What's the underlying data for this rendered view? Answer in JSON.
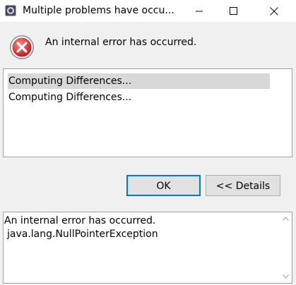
{
  "window": {
    "title": "Multiple problems have occu..."
  },
  "header": {
    "message": "An internal error has occurred."
  },
  "problems": [
    {
      "label": "Computing Differences...",
      "selected": true
    },
    {
      "label": "Computing Differences...",
      "selected": false
    }
  ],
  "buttons": {
    "ok_label": "OK",
    "details_label": "<< Details"
  },
  "details": {
    "lines": [
      "An internal error has occurred.",
      "java.lang.NullPointerException"
    ]
  },
  "colors": {
    "error_red": "#e04343",
    "focus_blue": "#0078d7",
    "selection_gray": "#d8d8d8"
  }
}
